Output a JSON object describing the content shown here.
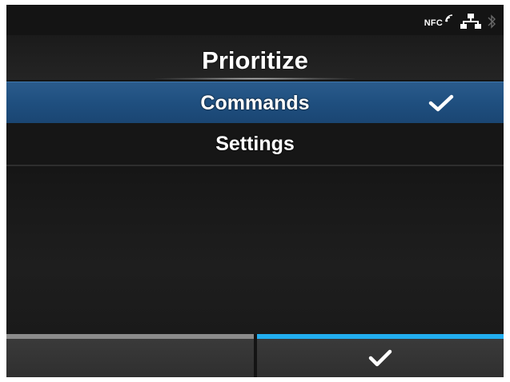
{
  "status_bar": {
    "nfc_label": "NFC",
    "icons": [
      "nfc-icon",
      "network-icon",
      "bluetooth-icon"
    ]
  },
  "screen": {
    "title": "Prioritize"
  },
  "menu": {
    "items": [
      {
        "label": "Commands",
        "selected": true,
        "checked": true
      },
      {
        "label": "Settings",
        "selected": false,
        "checked": false
      }
    ]
  },
  "footer": {
    "left_softkey_icon": "",
    "right_softkey_icon": "check-icon"
  },
  "colors": {
    "background": "#141414",
    "selection": "#1f4f7f",
    "left_key_bar": "#8c8c8c",
    "right_key_bar": "#22aef0",
    "text": "#ffffff"
  }
}
